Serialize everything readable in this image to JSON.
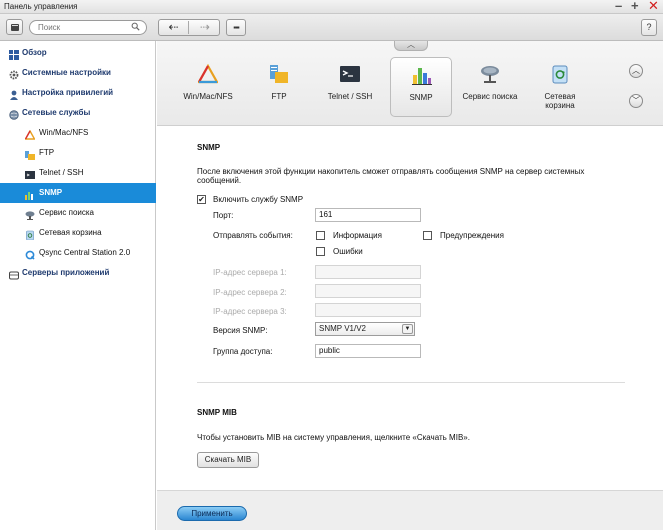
{
  "window": {
    "title": "Панель управления",
    "min": "–",
    "max": "+",
    "close": "✕"
  },
  "toolbar": {
    "search_placeholder": "Поиск",
    "back": "⇠",
    "forward": "⇢",
    "apps": "▪▪▪",
    "help": "?"
  },
  "sidebar": {
    "items": [
      {
        "label": "Обзор",
        "icon": "grid-icon"
      },
      {
        "label": "Системные настройки",
        "icon": "gear-icon"
      },
      {
        "label": "Настройка привилегий",
        "icon": "user-icon"
      },
      {
        "label": "Сетевые службы",
        "icon": "globe-icon"
      },
      {
        "label": "Win/Mac/NFS",
        "icon": "triangle-icon"
      },
      {
        "label": "FTP",
        "icon": "ftp-folder-icon"
      },
      {
        "label": "Telnet / SSH",
        "icon": "terminal-icon"
      },
      {
        "label": "SNMP",
        "icon": "bar-chart-icon",
        "active": true
      },
      {
        "label": "Сервис поиска",
        "icon": "satellite-dish-icon"
      },
      {
        "label": "Сетевая корзина",
        "icon": "recycle-bin-icon"
      },
      {
        "label": "Qsync Central Station 2.0",
        "icon": "qsync-icon"
      },
      {
        "label": "Серверы приложений",
        "icon": "server-icon"
      }
    ]
  },
  "iconbar": {
    "items": [
      {
        "label": "Win/Mac/NFS",
        "icon": "triangle-icon"
      },
      {
        "label": "FTP",
        "icon": "ftp-folder-icon"
      },
      {
        "label": "Telnet / SSH",
        "icon": "terminal-icon"
      },
      {
        "label": "SNMP",
        "icon": "bar-chart-icon",
        "selected": true
      },
      {
        "label": "Сервис поиска",
        "icon": "satellite-dish-icon"
      },
      {
        "label": "Сетевая корзина",
        "icon": "recycle-bin-icon"
      }
    ],
    "collapse": "︿",
    "scroll_up": "︿",
    "scroll_down": "﹀"
  },
  "snmp": {
    "heading": "SNMP",
    "description": "После включения этой функции накопитель сможет отправлять сообщения SNMP на сервер системных сообщений.",
    "enable_label": "Включить службу SNMP",
    "enable_checked": "✔",
    "port_label": "Порт:",
    "port_value": "161",
    "events_label": "Отправлять события:",
    "event_info": "Информация",
    "event_warnings": "Предупреждения",
    "event_errors": "Ошибки",
    "server1_label": "IP-адрес сервера 1:",
    "server2_label": "IP-адрес сервера 2:",
    "server3_label": "IP-адрес сервера 3:",
    "version_label": "Версия SNMP:",
    "version_value": "SNMP V1/V2",
    "group_label": "Группа доступа:",
    "group_value": "public"
  },
  "mib": {
    "heading": "SNMP MIB",
    "description": "Чтобы установить MIB на систему управления, щелкните «Скачать MIB».",
    "download_label": "Скачать MIB"
  },
  "footer": {
    "apply_label": "Применить"
  },
  "colors": {
    "accent": "#1a8bd9",
    "close": "#d21f1f",
    "nav_text": "#1e3a6e"
  }
}
